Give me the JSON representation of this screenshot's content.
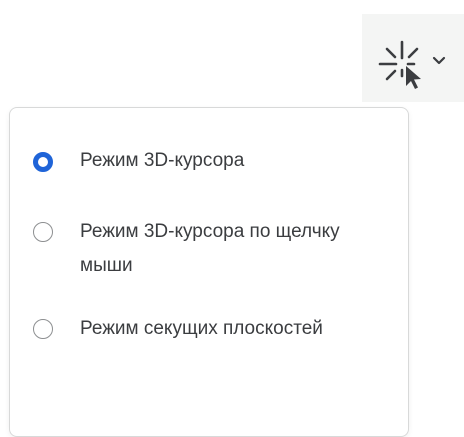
{
  "toolbar": {
    "cursor_tool_icon": "cursor-3d-icon",
    "dropdown_icon": "chevron-down-icon"
  },
  "menu": {
    "options": [
      {
        "label": "Режим 3D-курсора",
        "selected": true
      },
      {
        "label": "Режим 3D-курсора по щелчку мыши",
        "selected": false
      },
      {
        "label": "Режим секущих плоскостей",
        "selected": false
      }
    ]
  },
  "colors": {
    "accent": "#1f64d8",
    "text": "#3b3d40",
    "radio_border": "#8d8f91",
    "button_bg": "#f4f5f4",
    "popup_border": "#d8d9d9"
  }
}
